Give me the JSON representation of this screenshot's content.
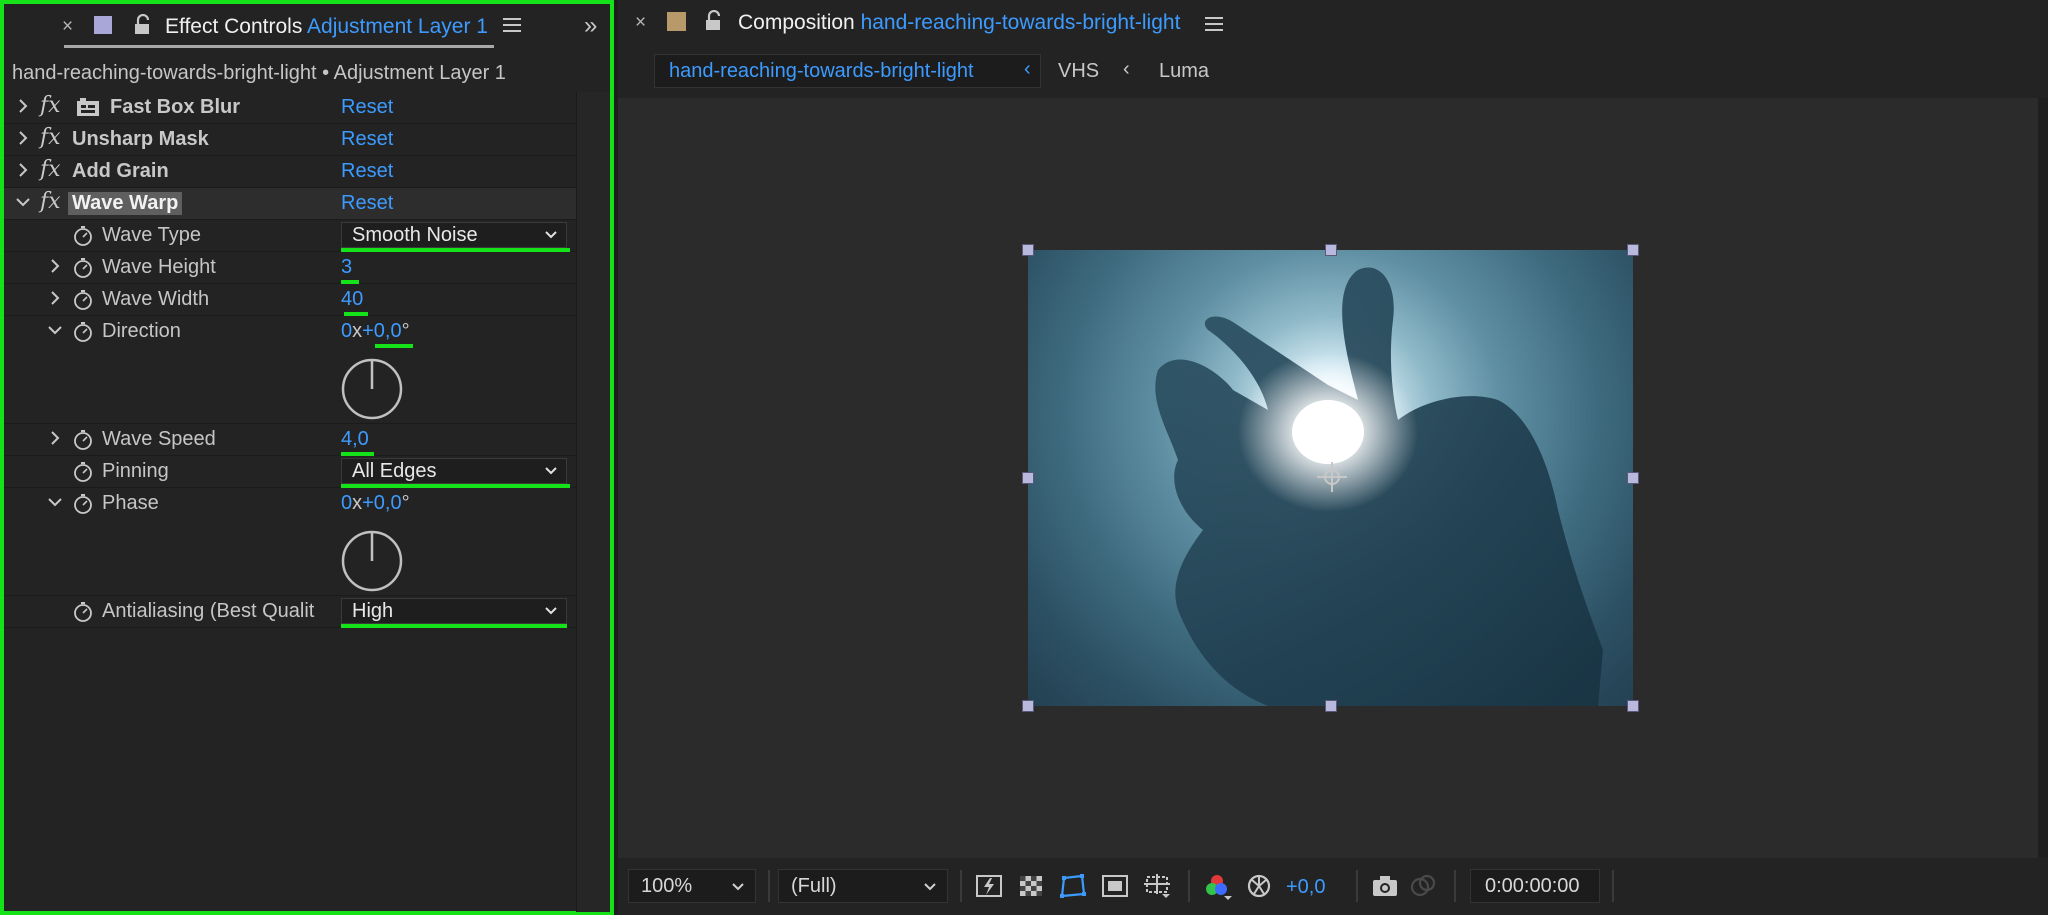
{
  "effect_controls": {
    "tab_close": "×",
    "tab_title": "Effect Controls",
    "tab_layer": "Adjustment Layer 1",
    "collapse_glyph": "»",
    "breadcrumb": "hand-reaching-towards-bright-light • Adjustment Layer 1",
    "effects": [
      {
        "label": "Fast Box Blur",
        "reset": "Reset",
        "fx": "fx",
        "icon": "gpu-accelerated-icon"
      },
      {
        "label": "Unsharp Mask",
        "reset": "Reset",
        "fx": "fx"
      },
      {
        "label": "Add Grain",
        "reset": "Reset",
        "fx": "fx"
      },
      {
        "label": "Wave Warp",
        "reset": "Reset",
        "fx": "fx",
        "expanded": true
      }
    ],
    "properties": {
      "wave_type": {
        "label": "Wave Type",
        "value": "Smooth Noise"
      },
      "wave_height": {
        "label": "Wave Height",
        "value": "3"
      },
      "wave_width": {
        "label": "Wave Width",
        "value": "40"
      },
      "direction": {
        "label": "Direction",
        "revs": "0",
        "x": "x",
        "deg": "+0,0",
        "unit": "°"
      },
      "wave_speed": {
        "label": "Wave Speed",
        "value": "4,0"
      },
      "pinning": {
        "label": "Pinning",
        "value": "All Edges"
      },
      "phase": {
        "label": "Phase",
        "revs": "0",
        "x": "x",
        "deg": "+0,0",
        "unit": "°"
      },
      "antialiasing": {
        "label": "Antialiasing (Best Qualit",
        "value": "High"
      }
    },
    "highlight_color": "#16e21a"
  },
  "composition": {
    "tab_close": "×",
    "tab_title": "Composition",
    "comp_name": "hand-reaching-towards-bright-light",
    "breadcrumbs": [
      "hand-reaching-towards-bright-light",
      "VHS",
      "Luma"
    ],
    "crumb_sep": "‹",
    "viewer": {
      "image": "hand reaching towards bright light"
    },
    "toolbar": {
      "zoom": "100%",
      "resolution": "(Full)",
      "exposure": "+0,0",
      "timecode": "0:00:00:00",
      "icons": [
        "fast-previews-icon",
        "transparency-grid-icon",
        "mask-path-visibility-icon",
        "region-of-interest-icon",
        "grid-guides-icon",
        "channel-icon",
        "color-management-icon",
        "snapshot-icon",
        "show-snapshot-icon"
      ]
    }
  },
  "accent_color": "#3d9bff"
}
